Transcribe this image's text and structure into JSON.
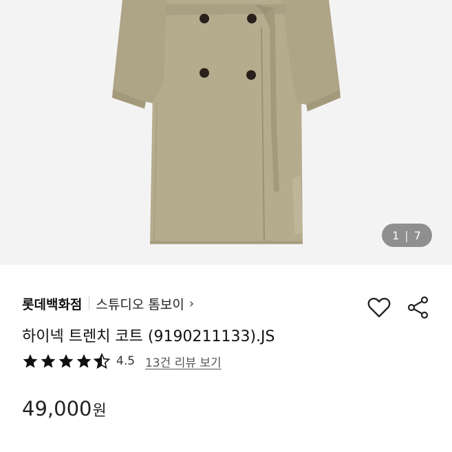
{
  "gallery": {
    "current": "1",
    "separator": "|",
    "total": "7",
    "image_icon": "product-photo-trench-coat"
  },
  "product": {
    "brand": "롯데백화점",
    "store": "스튜디오 톰보이",
    "store_chevron": "›",
    "title": "하이넥 트렌치 코트 (9190211133).JS",
    "rating": {
      "stars": 4.5,
      "value": "4.5",
      "reviews_link": "13건 리뷰 보기"
    },
    "price": {
      "amount": "49,000",
      "unit": "원"
    }
  },
  "actions": {
    "like_icon": "heart-icon",
    "share_icon": "share-icon"
  },
  "colors": {
    "coat": "#b5ac8e",
    "background": "#f4f3f4",
    "star": "#111111"
  }
}
